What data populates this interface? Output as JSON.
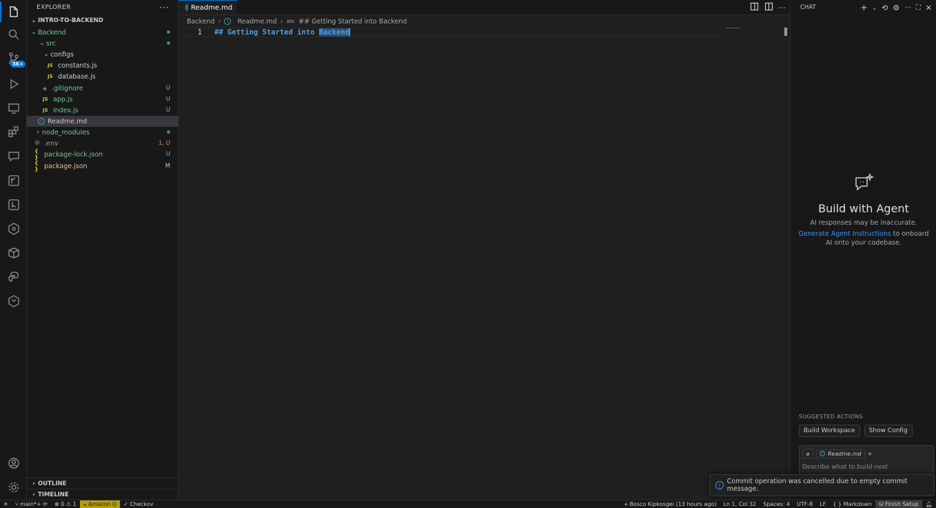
{
  "sidebar": {
    "header": "EXPLORER",
    "more": "···",
    "folder": "INTRO-TO-BACKEND",
    "tree": [
      {
        "label": "Backend",
        "status": "dot"
      },
      {
        "label": "src",
        "status": "dot"
      },
      {
        "label": "configs",
        "status": ""
      },
      {
        "label": "constants.js",
        "icon": "JS",
        "status": ""
      },
      {
        "label": "database.js",
        "icon": "JS",
        "status": ""
      },
      {
        "label": ".gitignore",
        "status": "U"
      },
      {
        "label": "app.js",
        "icon": "JS",
        "status": "U"
      },
      {
        "label": "index.js",
        "icon": "JS",
        "status": "U"
      },
      {
        "label": "Readme.md",
        "status": ""
      },
      {
        "label": "node_modules",
        "status": "dot"
      },
      {
        "label": ".env",
        "status": "1, U"
      },
      {
        "label": "package-lock.json",
        "icon": "{ }",
        "status": "U"
      },
      {
        "label": "package.json",
        "icon": "{ }",
        "status": "M"
      }
    ],
    "outline": "OUTLINE",
    "timeline": "TIMELINE"
  },
  "editor": {
    "tab": "Readme.md",
    "breadcrumb": [
      "Backend",
      "Readme.md",
      "## Getting Started into Backend"
    ],
    "line_number": "1",
    "code_prefix": "## Getting Started into ",
    "code_selected": "Backend"
  },
  "chat": {
    "header": "CHAT",
    "title": "Build with Agent",
    "subtitle": "AI responses may be inaccurate.",
    "link": "Generate Agent Instructions",
    "link_suffix": " to onboard AI onto your codebase.",
    "suggested_label": "SUGGESTED ACTIONS",
    "actions": [
      "Build Workspace",
      "Show Config"
    ],
    "attached_file": "Readme.md",
    "placeholder": "Describe what to build next"
  },
  "toast": {
    "message": "Commit operation was cancelled due to empty commit message."
  },
  "statusbar": {
    "branch": "main*+",
    "problems": "0",
    "warnings": "1",
    "amazon": "Amazon Q",
    "checkov": "Checkov",
    "blame": "Bosco Kipkosgei (13 hours ago)",
    "position": "Ln 1, Col 32",
    "spaces": "Spaces: 4",
    "encoding": "UTF-8",
    "eol": "LF",
    "language": "Markdown",
    "finish": "Finish Setup"
  },
  "activity_badge": "5K+"
}
